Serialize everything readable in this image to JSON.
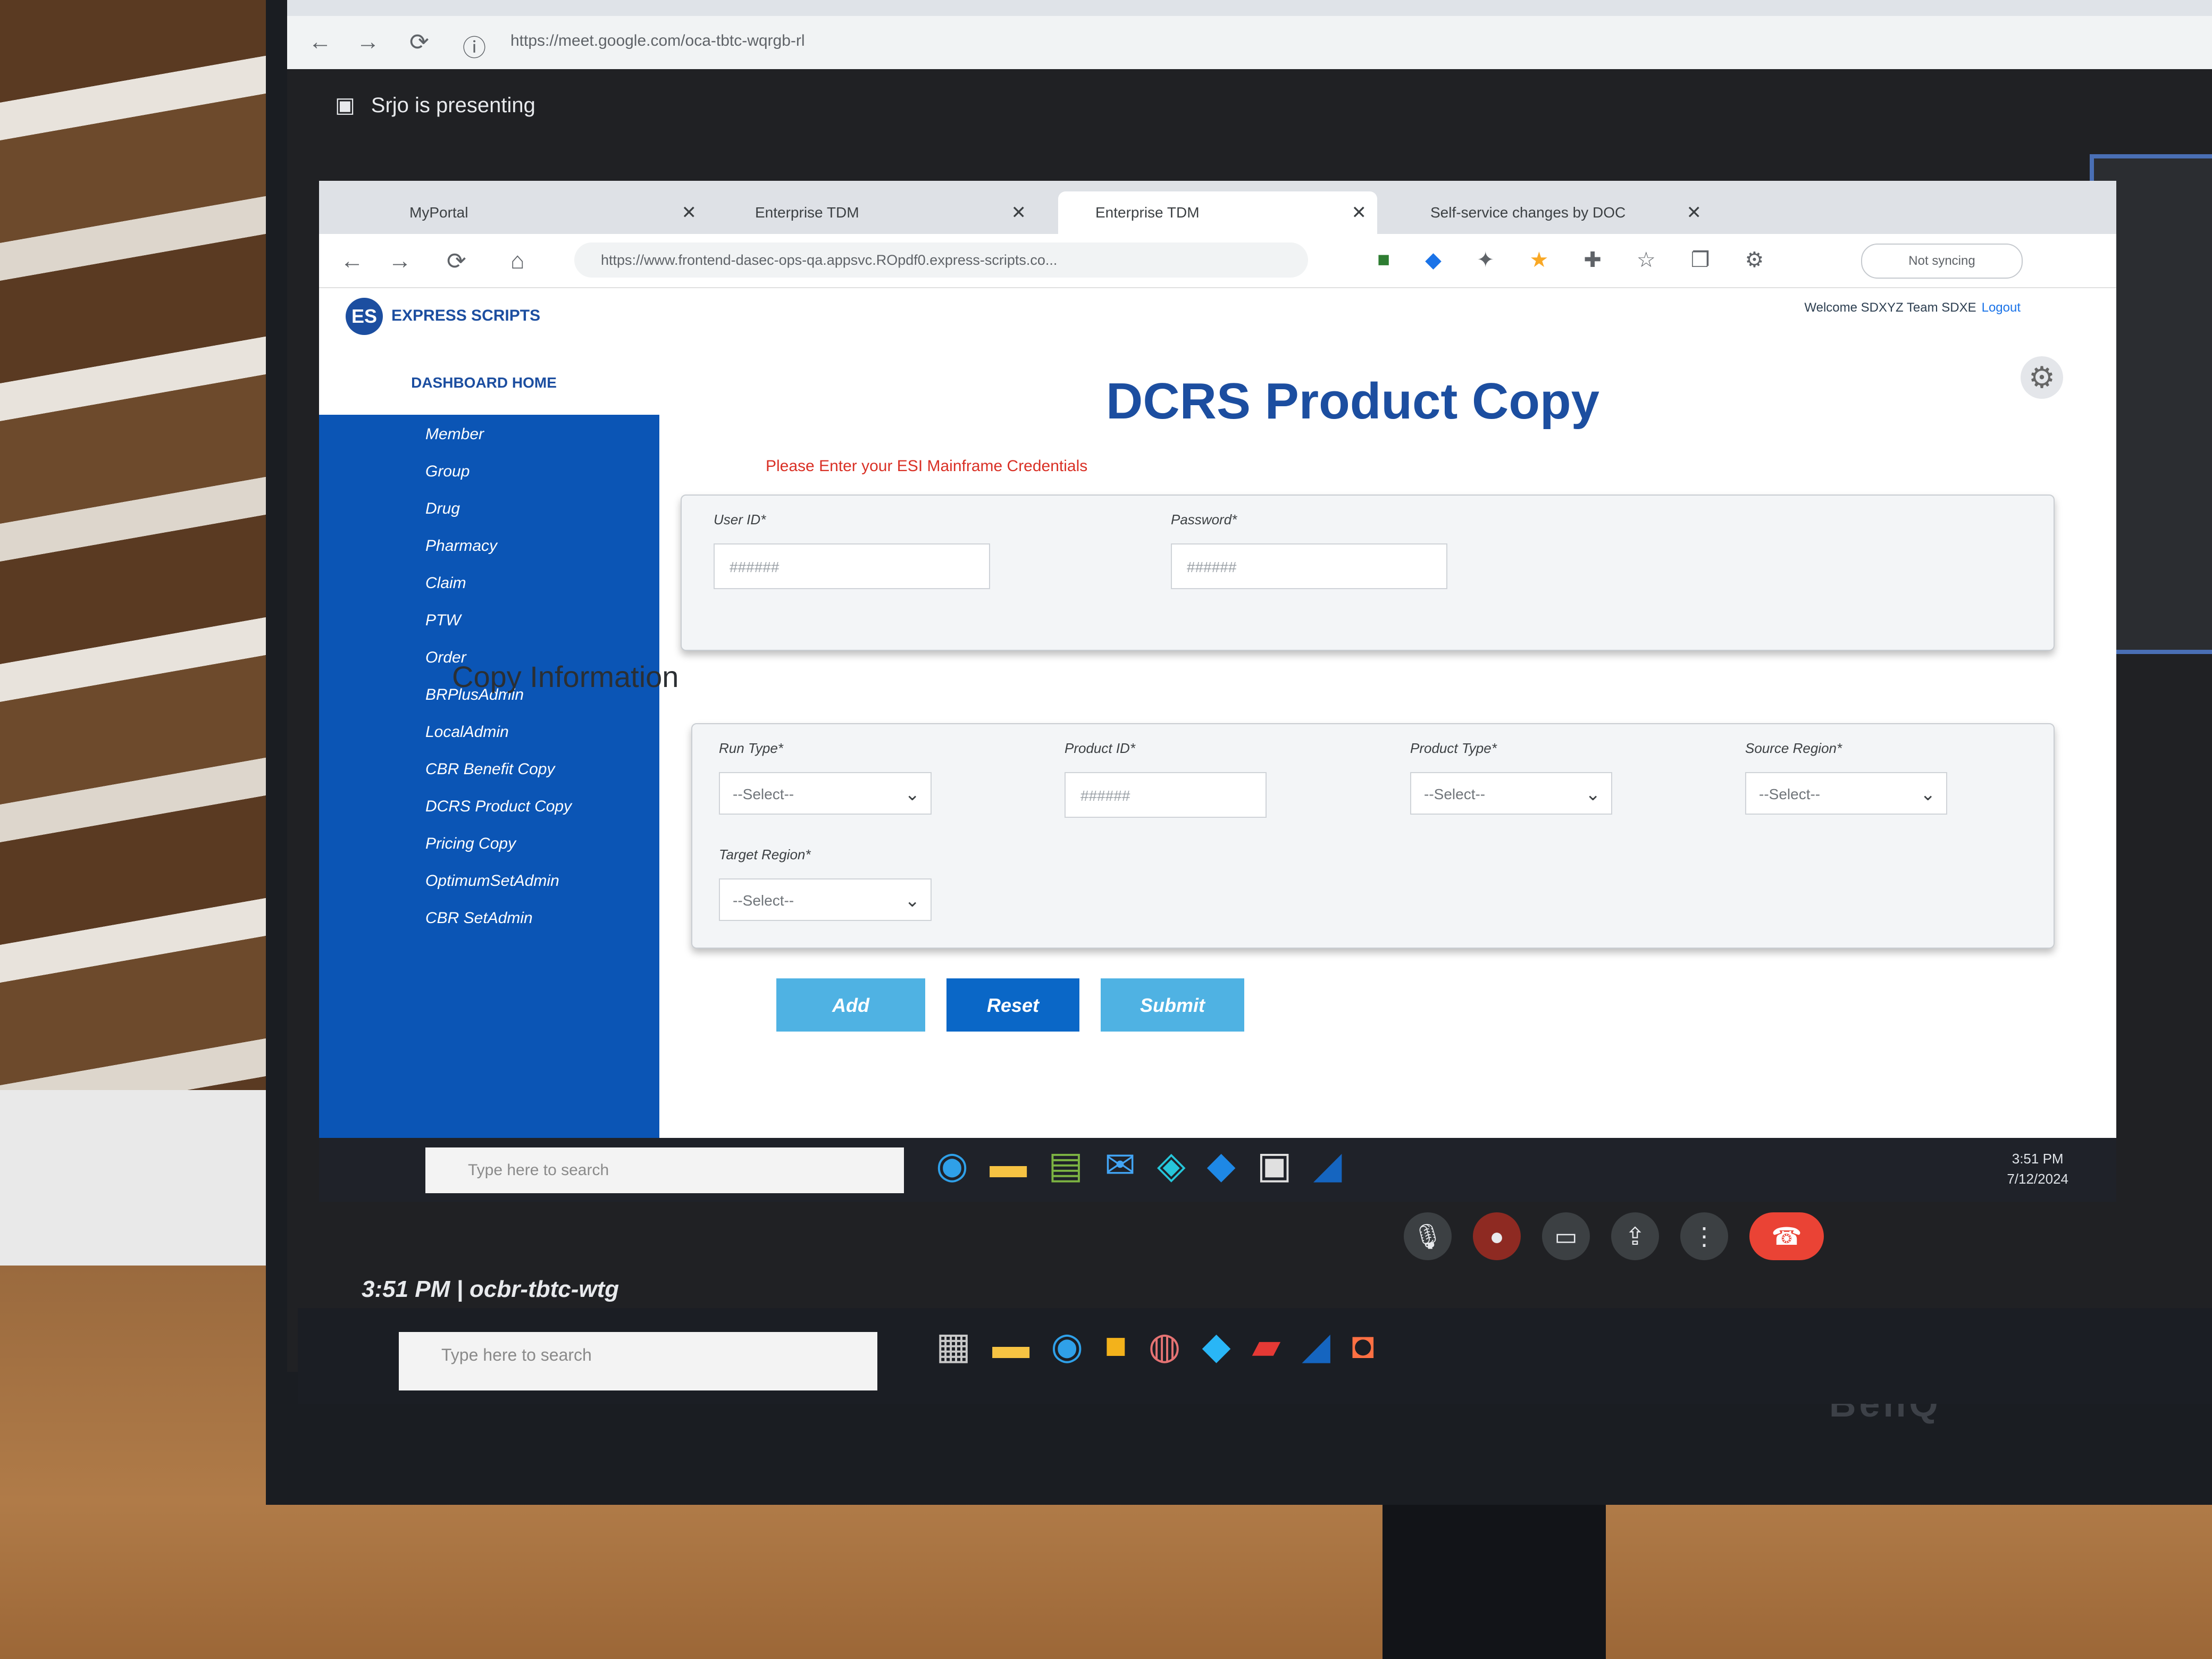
{
  "outer_browser": {
    "url": "https://meet.google.com/oca-tbtc-wqrgb-rl"
  },
  "meet": {
    "presenting_label": "Srjo is presenting",
    "time_meeting": "3:51 PM | ocbr-tbtc-wtg",
    "controls": [
      "mic-icon",
      "camera-icon",
      "captions-icon",
      "present-icon",
      "more-icon",
      "end-call-icon"
    ]
  },
  "inner_browser": {
    "tabs": [
      {
        "label": "MyPortal"
      },
      {
        "label": "Enterprise TDM"
      },
      {
        "label": "Enterprise TDM"
      },
      {
        "label": "Self-service changes by DOC"
      }
    ],
    "url": "https://www.frontend-dasec-ops-qa.appsvc.ROpdf0.express-scripts.co...",
    "profile_label": "Not syncing"
  },
  "app": {
    "logo_text": "EXPRESS SCRIPTS",
    "header_right": "Welcome SDXYZ Team SDXE",
    "header_link": "Logout",
    "sidebar_title": "DASHBOARD HOME",
    "sidebar_items": [
      "Member",
      "Group",
      "Drug",
      "Pharmacy",
      "Claim",
      "PTW",
      "Order",
      "BRPlusAdmin",
      "LocalAdmin",
      "CBR Benefit Copy",
      "DCRS Product Copy",
      "Pricing Copy",
      "OptimumSetAdmin",
      "CBR SetAdmin"
    ],
    "page_title": "DCRS Product Copy",
    "warning_text": "Please Enter your ESI Mainframe Credentials",
    "credentials": {
      "user_id_label": "User ID*",
      "user_id_placeholder": "######",
      "password_label": "Password*",
      "password_placeholder": "######"
    },
    "copy_section_title": "Copy Information",
    "copy": {
      "run_type_label": "Run Type*",
      "run_type_value": "--Select--",
      "product_id_label": "Product ID*",
      "product_id_placeholder": "######",
      "product_type_label": "Product Type*",
      "product_type_value": "--Select--",
      "source_region_label": "Source Region*",
      "source_region_value": "--Select--",
      "target_region_label": "Target Region*",
      "target_region_value": "--Select--"
    },
    "buttons": {
      "add": "Add",
      "reset": "Reset",
      "submit": "Submit"
    }
  },
  "inner_taskbar": {
    "search_placeholder": "Type here to search",
    "time": "3:51 PM",
    "date": "7/12/2024"
  },
  "outer_taskbar": {
    "search_placeholder": "Type here to search"
  },
  "colors": {
    "sidebar": "#0b55b5",
    "title": "#1c4ea0",
    "warning": "#d93025",
    "button_light": "#4fb2e3",
    "button_dark": "#0a67c7",
    "end_call": "#ea4335"
  },
  "monitor_brand": "BenQ"
}
